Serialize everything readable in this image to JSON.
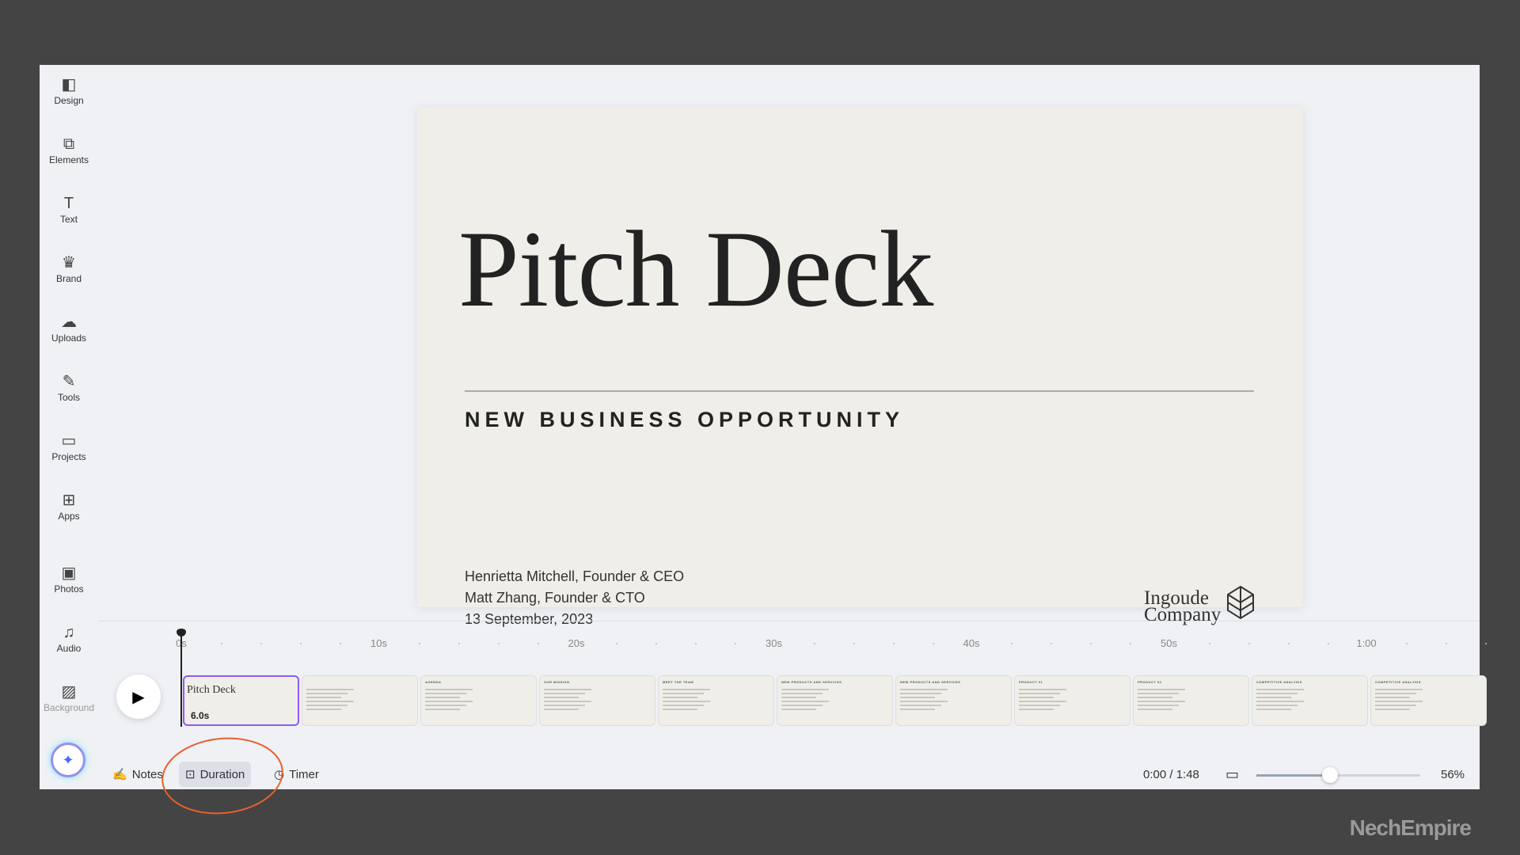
{
  "sidebar": {
    "items": [
      {
        "label": "Design",
        "icon": "layout-icon",
        "glyph": "◧"
      },
      {
        "label": "Elements",
        "icon": "shapes-icon",
        "glyph": "⧉"
      },
      {
        "label": "Text",
        "icon": "text-icon",
        "glyph": "T"
      },
      {
        "label": "Brand",
        "icon": "brand-icon",
        "glyph": "♛"
      },
      {
        "label": "Uploads",
        "icon": "cloud-upload-icon",
        "glyph": "☁"
      },
      {
        "label": "Tools",
        "icon": "pen-icon",
        "glyph": "✎"
      },
      {
        "label": "Projects",
        "icon": "folder-icon",
        "glyph": "▭"
      },
      {
        "label": "Apps",
        "icon": "apps-icon",
        "glyph": "⊞"
      },
      {
        "label": "Photos",
        "icon": "image-icon",
        "glyph": "▣"
      },
      {
        "label": "Audio",
        "icon": "music-icon",
        "glyph": "♫"
      },
      {
        "label": "Background",
        "icon": "background-icon",
        "glyph": "▨"
      }
    ]
  },
  "slide": {
    "title": "Pitch Deck",
    "subtitle": "NEW BUSINESS OPPORTUNITY",
    "names": [
      "Henrietta Mitchell, Founder & CEO",
      "Matt Zhang, Founder & CTO",
      "13 September, 2023"
    ],
    "logo": [
      "Ingoude",
      "Company"
    ]
  },
  "timeline": {
    "ruler": [
      "0s",
      "10s",
      "20s",
      "30s",
      "40s",
      "50s",
      "1:00"
    ],
    "thumbs": [
      {
        "title": "Pitch Deck",
        "duration": "6.0s"
      },
      {
        "title": ""
      },
      {
        "title": "AGENDA"
      },
      {
        "title": "OUR MISSION"
      },
      {
        "title": "MEET THE TEAM"
      },
      {
        "title": "NEW PRODUCTS AND SERVICES"
      },
      {
        "title": "NEW PRODUCTS AND SERVICES"
      },
      {
        "title": "PRODUCT 01"
      },
      {
        "title": "PRODUCT 02"
      },
      {
        "title": "COMPETITIVE ANALYSIS"
      },
      {
        "title": "COMPETITIVE ANALYSIS"
      }
    ]
  },
  "bottom": {
    "notes": "Notes",
    "duration": "Duration",
    "timer": "Timer",
    "time": "0:00 / 1:48",
    "zoom": "56%",
    "zoom_value": 56
  },
  "colors": {
    "accent": "#8b5cf6",
    "annotation": "#e8602c"
  },
  "watermark": "NechEmpire"
}
